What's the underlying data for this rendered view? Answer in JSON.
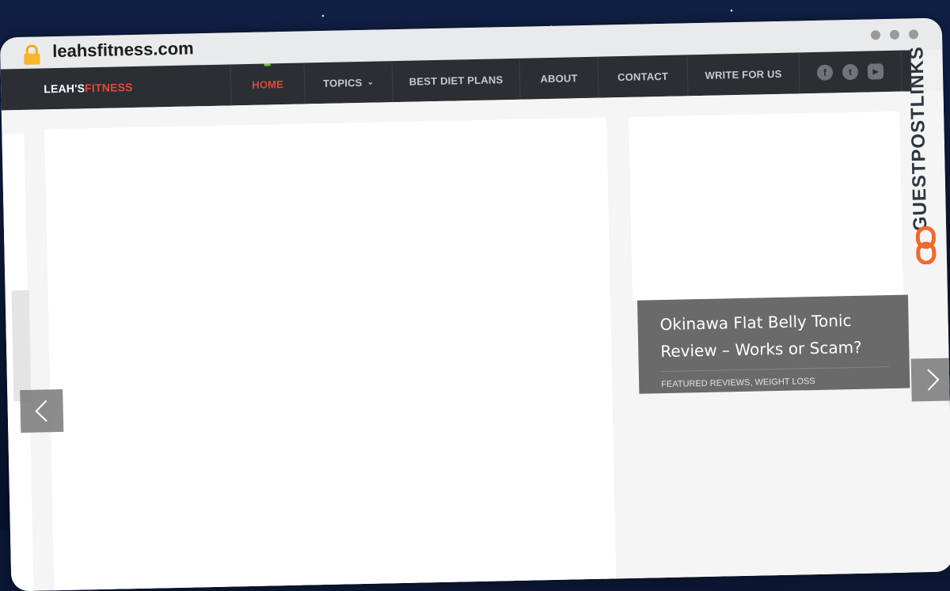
{
  "browser": {
    "url": "leahsfitness.com",
    "icons": {
      "lock": "lock-icon",
      "window_dots": [
        "dot",
        "dot",
        "dot"
      ]
    }
  },
  "site": {
    "logo": {
      "part1": "LEAH'S",
      "part2": "FITNESS",
      "accent_color": "#e8453c"
    },
    "nav": [
      {
        "label": "HOME",
        "active": true
      },
      {
        "label": "TOPICS",
        "has_dropdown": true
      },
      {
        "label": "BEST DIET PLANS"
      },
      {
        "label": "ABOUT"
      },
      {
        "label": "CONTACT"
      },
      {
        "label": "WRITE FOR US"
      }
    ],
    "social": [
      {
        "icon": "facebook-icon",
        "glyph": "f"
      },
      {
        "icon": "twitter-icon",
        "glyph": "t"
      },
      {
        "icon": "youtube-icon",
        "glyph": "▶"
      }
    ]
  },
  "slider": {
    "featured": {
      "title": "Okinawa Flat Belly Tonic Review – Works or Scam?",
      "categories": "FEATURED REVIEWS, WEIGHT LOSS"
    },
    "arrows": {
      "left": "chevron-left-icon",
      "right": "chevron-right-icon"
    }
  },
  "watermark": {
    "text": "GUESTPOSTLINKS"
  }
}
